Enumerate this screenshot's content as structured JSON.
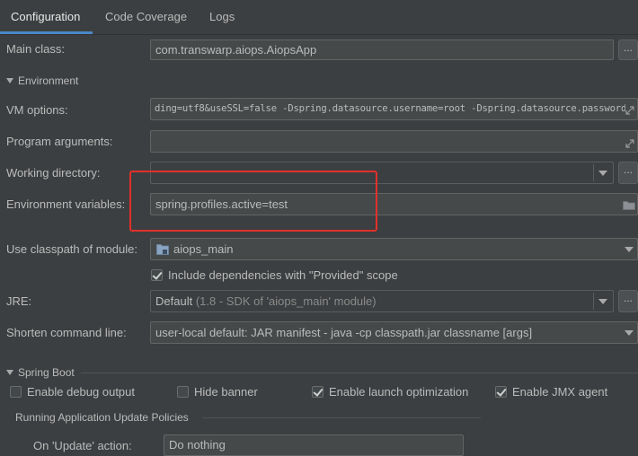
{
  "tabs": [
    {
      "label": "Configuration",
      "active": true
    },
    {
      "label": "Code Coverage",
      "active": false
    },
    {
      "label": "Logs",
      "active": false
    }
  ],
  "main_class": {
    "label": "Main class:",
    "value": "com.transwarp.aiops.AiopsApp",
    "button": "..."
  },
  "environment": {
    "section_label": "Environment",
    "vm_options": {
      "label": "VM options:",
      "value": "ding=utf8&useSSL=false -Dspring.datasource.username=root -Dspring.datasource.password="
    },
    "program_arguments": {
      "label": "Program arguments:",
      "value": ""
    },
    "working_directory": {
      "label": "Working directory:",
      "value": "",
      "button": "..."
    },
    "environment_variables": {
      "label": "Environment variables:",
      "value": "spring.profiles.active=test"
    }
  },
  "classpath": {
    "label": "Use classpath of module:",
    "value": "aiops_main"
  },
  "include_dependencies": {
    "label": "Include dependencies with \"Provided\" scope",
    "checked": true
  },
  "jre": {
    "label": "JRE:",
    "value": "Default",
    "hint": "(1.8 - SDK of 'aiops_main' module)",
    "button": "..."
  },
  "shorten_command_line": {
    "label": "Shorten command line:",
    "value": "user-local default: JAR manifest - java -cp classpath.jar classname [args]"
  },
  "spring_boot": {
    "section_label": "Spring Boot",
    "options": [
      {
        "label": "Enable debug output",
        "checked": false
      },
      {
        "label": "Hide banner",
        "checked": false
      },
      {
        "label": "Enable launch optimization",
        "checked": true
      },
      {
        "label": "Enable JMX agent",
        "checked": true
      }
    ],
    "update_policies": {
      "title": "Running Application Update Policies",
      "on_update": {
        "label": "On 'Update' action:",
        "value": "Do nothing"
      }
    }
  },
  "colors": {
    "accent": "#4a88c7",
    "highlight_box": "#e0302b",
    "background": "#3c3f41"
  },
  "icons": [
    "expand-icon",
    "folder-icon",
    "module-icon",
    "chevron-down-icon",
    "checkbox-icon"
  ]
}
